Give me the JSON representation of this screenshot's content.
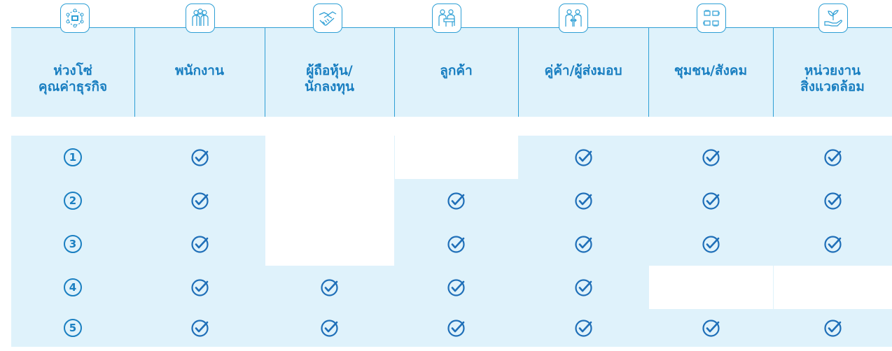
{
  "columns": [
    {
      "key": "chain",
      "title_lines": [
        "ห่วงโซ่",
        "คุณค่าธุรกิจ"
      ],
      "icon": "network-nodes-icon"
    },
    {
      "key": "employees",
      "title_lines": [
        "พนักงาน"
      ],
      "icon": "team-people-icon"
    },
    {
      "key": "shareholders",
      "title_lines": [
        "ผู้ถือหุ้น/",
        "นักลงทุน"
      ],
      "icon": "handshake-icon"
    },
    {
      "key": "customers",
      "title_lines": [
        "ลูกค้า"
      ],
      "icon": "service-counter-icon"
    },
    {
      "key": "partners",
      "title_lines": [
        "คู่ค้า/ผู้ส่งมอบ"
      ],
      "icon": "exchange-people-icon"
    },
    {
      "key": "community",
      "title_lines": [
        "ชุมชน/สังคม"
      ],
      "icon": "hands-together-icon"
    },
    {
      "key": "environment",
      "title_lines": [
        "หน่วยงาน",
        "สิ่งแวดล้อม"
      ],
      "icon": "plant-in-hand-icon"
    }
  ],
  "rows": [
    {
      "number": "1",
      "checks": [
        true,
        false,
        false,
        true,
        true,
        true
      ]
    },
    {
      "number": "2",
      "checks": [
        true,
        false,
        true,
        true,
        true,
        true
      ]
    },
    {
      "number": "3",
      "checks": [
        true,
        false,
        true,
        true,
        true,
        true
      ]
    },
    {
      "number": "4",
      "checks": [
        true,
        true,
        true,
        true,
        false,
        false
      ]
    },
    {
      "number": "5",
      "checks": [
        true,
        true,
        true,
        true,
        true,
        true
      ]
    }
  ],
  "colors": {
    "accent": "#1a7fc1",
    "line": "#2e9fd5",
    "band": "#dff2fb",
    "check": "#1f6fb8"
  }
}
